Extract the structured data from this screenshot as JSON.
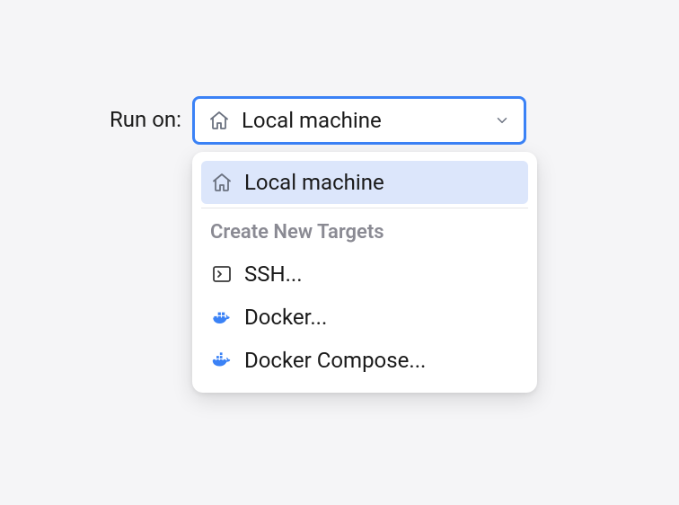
{
  "label": "Run on:",
  "select": {
    "value": "Local machine",
    "icon": "home-icon"
  },
  "dropdown": {
    "selected": {
      "label": "Local machine",
      "icon": "home-icon"
    },
    "section_header": "Create New Targets",
    "targets": [
      {
        "label": "SSH...",
        "icon": "terminal-icon"
      },
      {
        "label": "Docker...",
        "icon": "docker-icon"
      },
      {
        "label": "Docker Compose...",
        "icon": "docker-compose-icon"
      }
    ]
  }
}
